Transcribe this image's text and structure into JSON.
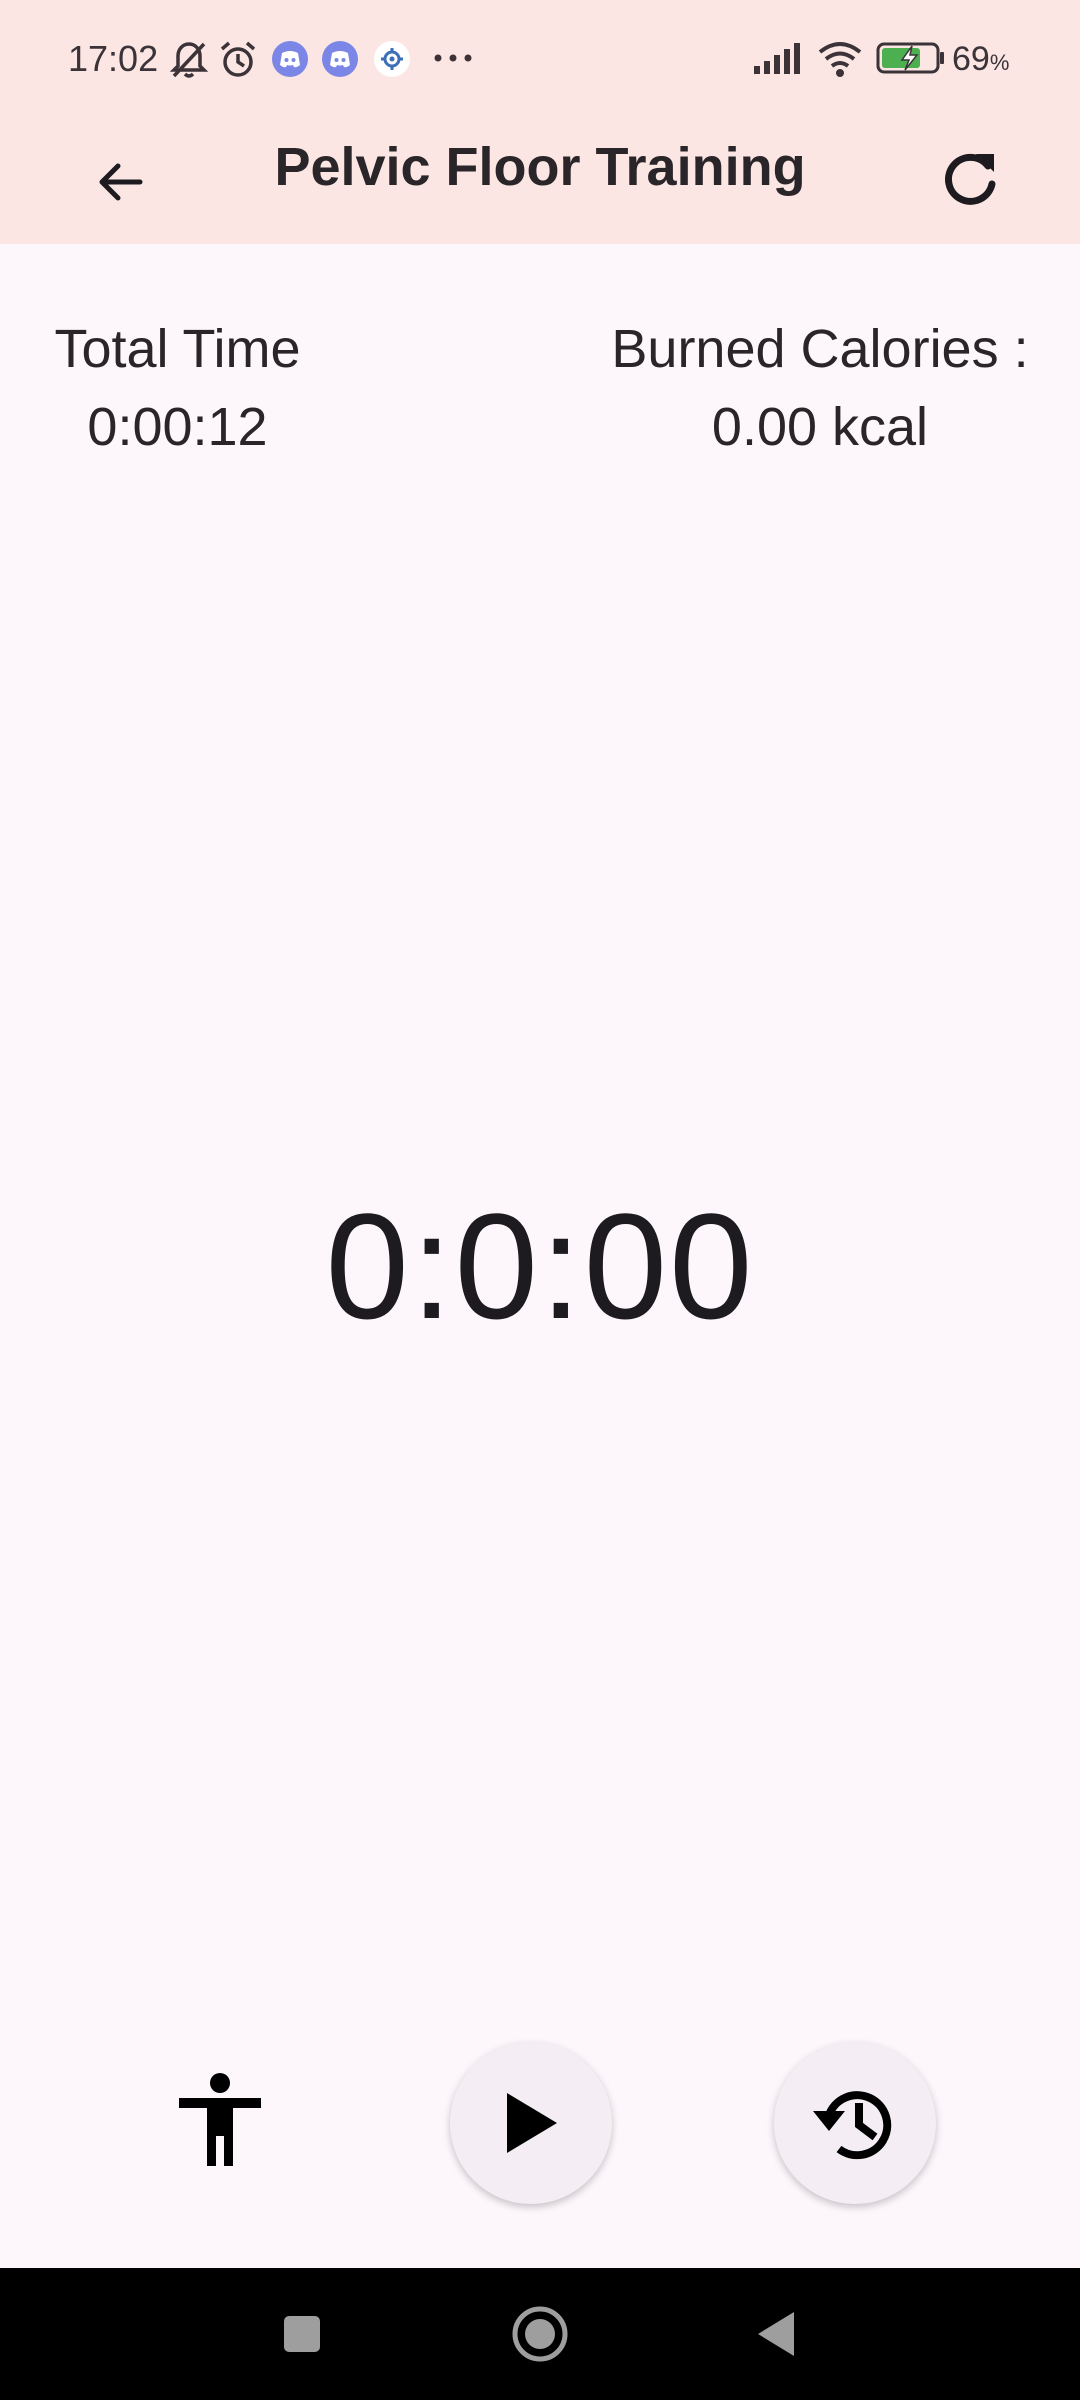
{
  "status_bar": {
    "time": "17:02",
    "battery_percent": "69",
    "battery_unit": "%",
    "icons": [
      "bell-off-icon",
      "alarm-icon",
      "discord-icon",
      "discord-icon",
      "app-icon",
      "more-icon",
      "signal-icon",
      "wifi-icon",
      "battery-charging-icon"
    ]
  },
  "app_bar": {
    "title": "Pelvic Floor Training",
    "back_icon": "arrow-back-icon",
    "refresh_icon": "refresh-icon"
  },
  "stats": {
    "total_time_label": "Total Time",
    "total_time_value": "0:00:12",
    "calories_label": "Burned Calories :",
    "calories_value": "0.00 kcal"
  },
  "timer": {
    "display": "0:0:00"
  },
  "controls": {
    "accessibility_icon": "accessibility-icon",
    "play_icon": "play-icon",
    "history_icon": "history-icon"
  },
  "nav_bar": {
    "icons": [
      "recents-icon",
      "home-icon",
      "back-icon"
    ]
  },
  "colors": {
    "top_bar_bg": "#fbe6e4",
    "page_bg": "#fdf7fc",
    "fab_bg": "#f4eef4",
    "discord": "#7c86e6"
  }
}
